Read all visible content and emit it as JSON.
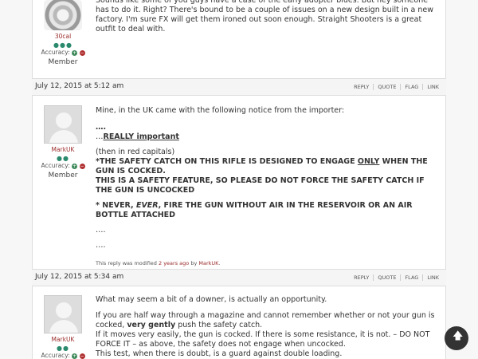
{
  "posts": [
    {
      "author": "30cal",
      "rank_dots": "●●●",
      "accuracy_label": "Accuracy:",
      "role": "Member",
      "text": "Sounds like some of you guys have a case of the early adopter blues. But hey someone has to do it. Right? There's bound to be a couple of issues on a new design built in a new factory. I'm sure FX will get them ironed out soon enough. Straight Shooters is a great outfit to deal with."
    },
    {
      "date": "July 12, 2015 at 5:12 am",
      "actions": [
        "REPLY",
        "QUOTE",
        "FLAG",
        "LINK"
      ],
      "author": "MarkUK",
      "rank_dots": "●●",
      "accuracy_label": "Accuracy:",
      "role": "Member",
      "line1": "Mine, in the UK came with the following notice from the importer:",
      "line2": "….",
      "line3_prefix": "…",
      "line3_bold": "REALLY important",
      "line4": "(then in red capitals)",
      "warn1a": "*THE SAFETY CATCH ON THIS RIFLE IS DESIGNED TO ENGAGE ",
      "warn1b": "ONLY",
      "warn1c": " WHEN THE GUN IS COCKED.",
      "warn2": "THIS IS A SAFETY FEATURE, SO PLEASE DO NOT FORCE THE SAFETY CATCH IF THE GUN IS UNCOCKED",
      "warn3a": "* NEVER, ",
      "warn3b": "EVER",
      "warn3c": ", FIRE THE GUN WITHOUT AIR IN THE RESERVOIR OR AN AIR BOTTLE ATTACHED",
      "dots1": "….",
      "dots2": "….",
      "mod_prefix": "This reply was modified ",
      "mod_time": "2 years ago",
      "mod_by": " by ",
      "mod_user": "MarkUK",
      "mod_end": "."
    },
    {
      "date": "July 12, 2015 at 5:34 am",
      "actions": [
        "REPLY",
        "QUOTE",
        "FLAG",
        "LINK"
      ],
      "author": "MarkUK",
      "rank_dots": "●●",
      "accuracy_label": "Accuracy:",
      "p1": "What may seem a bit of a downer, is actually an opportunity.",
      "p2a": "If you are half way through a magazine and cannot remember whether or not your gun is cocked, ",
      "p2b": "very gently",
      "p2c": " push the safety catch.",
      "p3": "If it moves very easily, the gun is cocked. If there is some resistance, it is not. – DO NOT FORCE IT – as above, the safety does not engage when uncocked.",
      "p4": "This test, when there is doubt, is a guard against double loading."
    }
  ],
  "scroll_top_icon": "arrow-up-icon"
}
